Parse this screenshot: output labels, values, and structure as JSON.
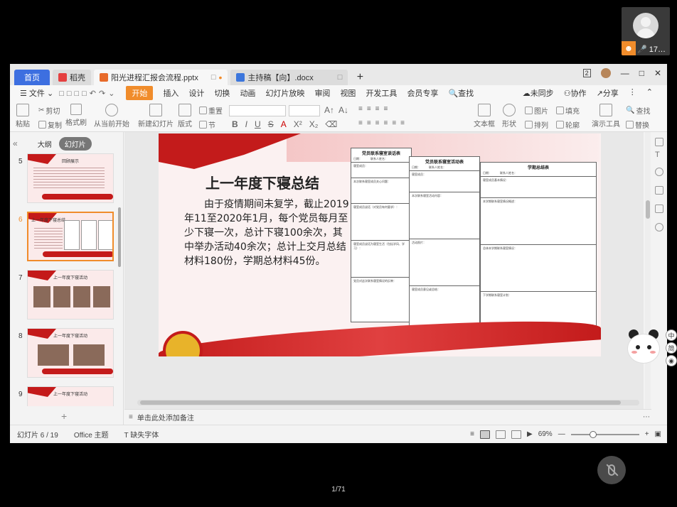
{
  "participant": {
    "name": "17…",
    "badge_icon": "person-icon",
    "mic_icon": "microphone-icon"
  },
  "titlebar": {
    "home_tab": "首页",
    "tabs": [
      {
        "label": "稻壳"
      },
      {
        "label": "阳光进程汇报会流程.pptx"
      },
      {
        "label": "主持稿【向】.docx"
      }
    ],
    "window_count": "2"
  },
  "menubar": {
    "file": "文件",
    "items": [
      "开始",
      "插入",
      "设计",
      "切换",
      "动画",
      "幻灯片放映",
      "审阅",
      "视图",
      "开发工具",
      "会员专享"
    ],
    "search": "查找",
    "right": [
      "未同步",
      "协作",
      "分享"
    ]
  },
  "ribbon": {
    "paste": "粘贴",
    "cut": "剪切",
    "copy": "复制",
    "format_painter": "格式刷",
    "from_current": "从当前开始",
    "new_slide": "新建幻灯片",
    "layout": "版式",
    "section": "节",
    "reset": "重置",
    "textbox": "文本框",
    "shape": "形状",
    "picture": "图片",
    "fill": "填充",
    "arrange": "排列",
    "outline": "轮廓",
    "present_tools": "演示工具",
    "find": "查找",
    "replace": "替换"
  },
  "left_panel": {
    "outline_tab": "大纲",
    "slides_tab": "幻灯片",
    "slides": [
      {
        "num": "5",
        "title": "回顾展示"
      },
      {
        "num": "6",
        "title": "上一年度下寝总结"
      },
      {
        "num": "7",
        "title": "上一年度下寝活动"
      },
      {
        "num": "8",
        "title": "上一年度下寝活动"
      },
      {
        "num": "9",
        "title": "上一年度下寝活动"
      }
    ]
  },
  "slide": {
    "title": "上一年度下寝总结",
    "body": "由于疫情期间未复学，截止2019年11至2020年1月，每个党员每月至少下寝一次，总计下寝100余次，其中举办活动40余次；总计上交月总结材料180份，学期总材料45份。",
    "form1": {
      "title": "党员联系寝室谈话表",
      "sub": "日期：　　　联系人姓名：",
      "cells": [
        "寝室成员：",
        "本次联系寝室成员关心问题：",
        "寝室成员谈话（对党员有何要求）：",
        "寝室成员谈话为寝室生活（包括学风、学习）：",
        "党员对这次联系寝室情况的反映："
      ]
    },
    "form2": {
      "title": "党员联系寝室活动表",
      "sub": "日期：　　　联系人姓名：",
      "cells": [
        "寝室成员：",
        "本次联系寝室活动内容：",
        "活动照片：",
        "寝室成员意见或总结："
      ]
    },
    "form3": {
      "title": "学期总结表",
      "sub": "日期：　　　联系人姓名：",
      "cells": [
        "寝室成员基本情况：",
        "本学期联系寝室情况概述：",
        "总体本学期联系寝室情况：",
        "下学期联系寝室计划："
      ]
    }
  },
  "notes_placeholder": "单击此处添加备注",
  "status": {
    "slide_pos": "幻灯片 6 / 19",
    "theme": "Office 主题",
    "missing_font": "缺失字体",
    "zoom": "69%"
  },
  "side_buttons": [
    "中",
    "简"
  ],
  "meeting": {
    "page_count": "1/71"
  }
}
